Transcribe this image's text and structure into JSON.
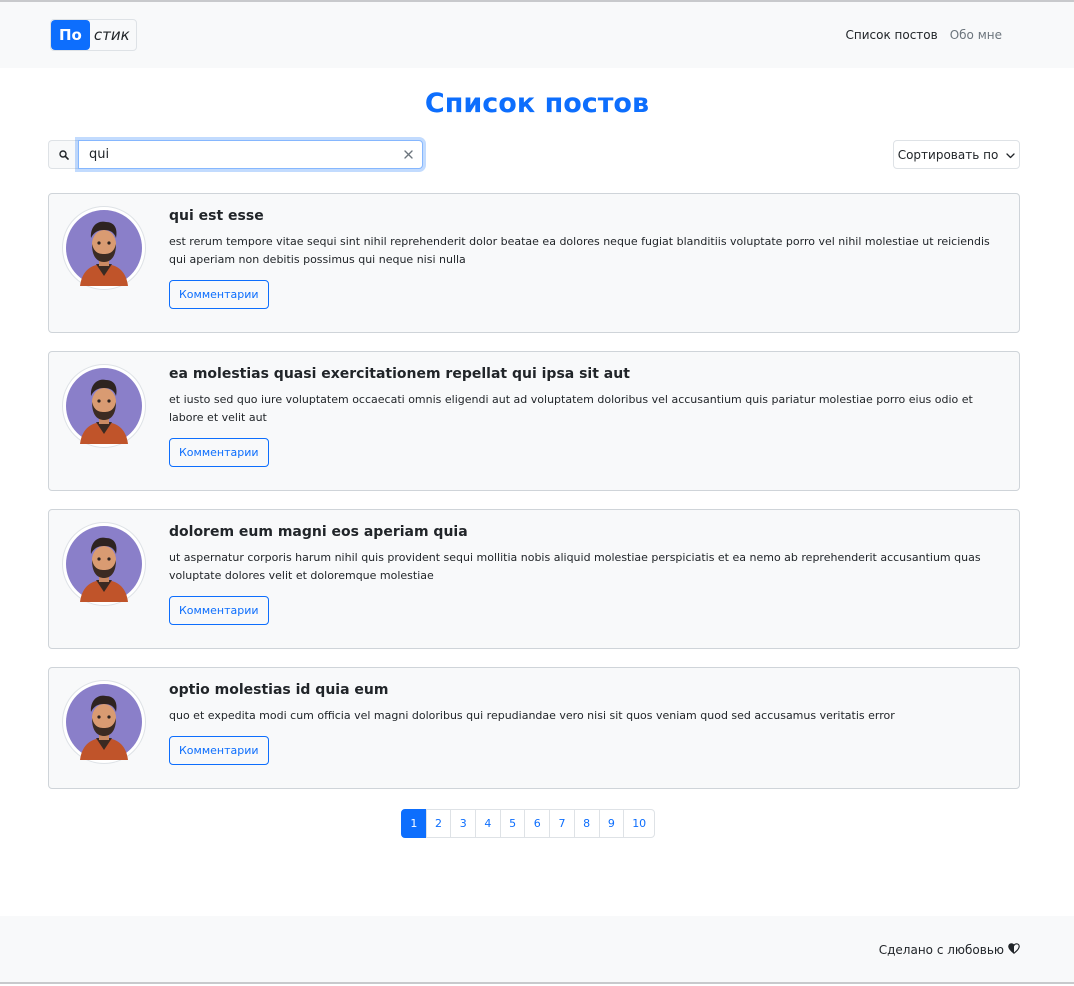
{
  "navbar": {
    "brand_part1": "По",
    "brand_part2": "стик",
    "links": [
      {
        "label": "Список постов",
        "active": true
      },
      {
        "label": "Обо мне",
        "active": false
      }
    ]
  },
  "page": {
    "title": "Список постов"
  },
  "search": {
    "value": "qui",
    "icon": "search-icon",
    "clear_icon": "close-icon"
  },
  "sort": {
    "label": "Сортировать по",
    "icon": "chevron-down-icon"
  },
  "posts": [
    {
      "title": "qui est esse",
      "body": "est rerum tempore vitae sequi sint nihil reprehenderit dolor beatae ea dolores neque fugiat blanditiis voluptate porro vel nihil molestiae ut reiciendis qui aperiam non debitis possimus qui neque nisi nulla",
      "button": "Комментарии"
    },
    {
      "title": "ea molestias quasi exercitationem repellat qui ipsa sit aut",
      "body": "et iusto sed quo iure voluptatem occaecati omnis eligendi aut ad voluptatem doloribus vel accusantium quis pariatur molestiae porro eius odio et labore et velit aut",
      "button": "Комментарии"
    },
    {
      "title": "dolorem eum magni eos aperiam quia",
      "body": "ut aspernatur corporis harum nihil quis provident sequi mollitia nobis aliquid molestiae perspiciatis et ea nemo ab reprehenderit accusantium quas voluptate dolores velit et doloremque molestiae",
      "button": "Комментарии"
    },
    {
      "title": "optio molestias id quia eum",
      "body": "quo et expedita modi cum officia vel magni doloribus qui repudiandae vero nisi sit quos veniam quod sed accusamus veritatis error",
      "button": "Комментарии"
    }
  ],
  "pagination": {
    "pages": [
      "1",
      "2",
      "3",
      "4",
      "5",
      "6",
      "7",
      "8",
      "9",
      "10"
    ],
    "active": "1"
  },
  "footer": {
    "text": "Сделано с любовью",
    "icon": "heart-half-icon"
  },
  "colors": {
    "primary": "#0d6efd",
    "avatar_bg": "#8a7fc9"
  }
}
